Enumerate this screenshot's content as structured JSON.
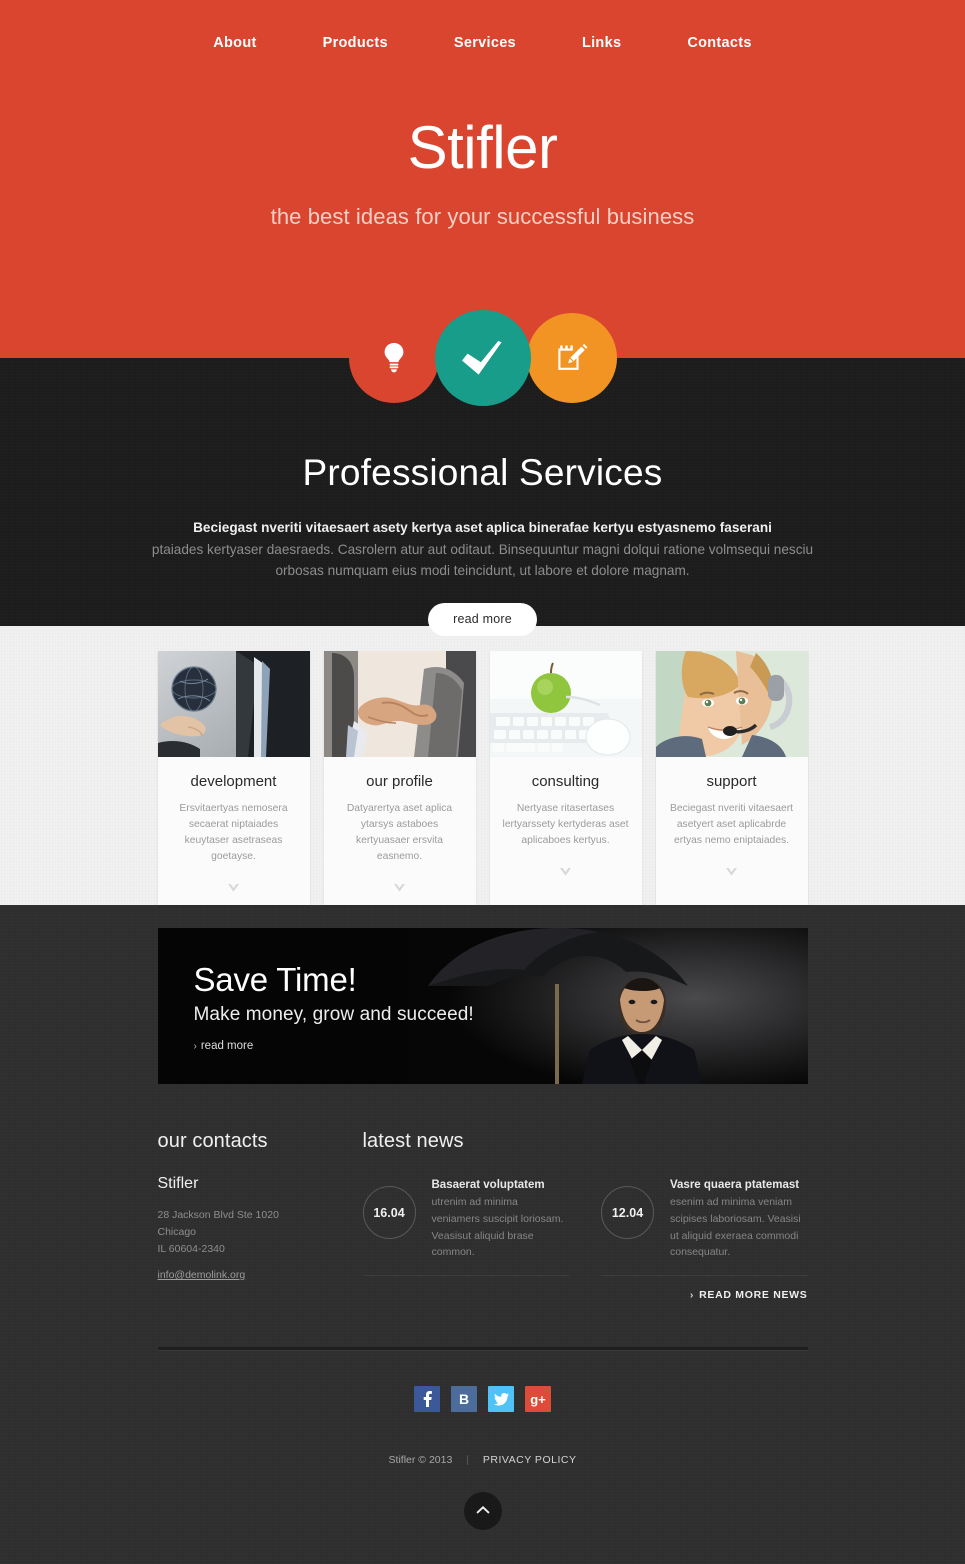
{
  "nav": {
    "items": [
      {
        "label": "About"
      },
      {
        "label": "Products"
      },
      {
        "label": "Services"
      },
      {
        "label": "Links"
      },
      {
        "label": "Contacts"
      }
    ]
  },
  "hero": {
    "brand": "Stifler",
    "tagline": "the best ideas for your successful business",
    "bg_color": "#d9452f",
    "badges": [
      {
        "name": "lightbulb-icon",
        "color": "#d9452f"
      },
      {
        "name": "check-icon",
        "color": "#179d8a"
      },
      {
        "name": "notepad-pencil-icon",
        "color": "#f29423"
      }
    ]
  },
  "intro": {
    "heading": "Professional Services",
    "lead": "Beciegast nveriti vitaesaert asety kertya aset aplica binerafae kertyu estyasnemo faserani",
    "sub": "ptaiades kertyaser daesraeds. Casrolern atur aut oditaut. Binsequuntur magni dolqui ratione volmsequi nesciu orbosas numquam eius modi teincidunt, ut labore et dolore magnam.",
    "button": "read more"
  },
  "cards": [
    {
      "title": "development",
      "text": "Ersvitaertyas nemosera secaerat niptaiades keuytaser asetraseas goetayse.",
      "image": "businessman-globe-photo"
    },
    {
      "title": "our profile",
      "text": "Datyarertya aset aplica ytarsys astaboes kertyuasaer ersvita easnemo.",
      "image": "handshake-photo"
    },
    {
      "title": "consulting",
      "text": "Nertyase ritasertases lertyarssety kertyderas aset aplicaboes kertyus.",
      "image": "apple-keyboard-photo"
    },
    {
      "title": "support",
      "text": "Beciegast nveriti vitaesaert asetyert aset aplicabrde ertyas nemo eniptaiades.",
      "image": "headset-operator-photo"
    }
  ],
  "promo": {
    "title": "Save Time!",
    "subtitle": "Make money, grow and succeed!",
    "link": "read more",
    "image": "man-with-umbrella-photo"
  },
  "contacts": {
    "heading": "our contacts",
    "company": "Stifler",
    "address_line1": "28 Jackson Blvd Ste 1020",
    "address_line2": "Chicago",
    "address_line3": "IL 60604-2340",
    "email": "info@demolink.org"
  },
  "news": {
    "heading": "latest news",
    "items": [
      {
        "date": "16.04",
        "title": "Basaerat voluptatem",
        "text": "utrenim ad minima veniamers suscipit loriosam. Veasisut aliquid brase common."
      },
      {
        "date": "12.04",
        "title": "Vasre quaera ptatemast",
        "text": "esenim ad minima veniam scipises laboriosam. Veasisi ut aliquid exeraea commodi consequatur."
      }
    ],
    "read_more": "READ MORE NEWS"
  },
  "socials": [
    {
      "name": "facebook-icon",
      "glyph": "f",
      "color": "#3b5998"
    },
    {
      "name": "vk-icon",
      "glyph": "B",
      "color": "#4c6c9b"
    },
    {
      "name": "twitter-icon",
      "glyph": "t",
      "color": "#4fc3f7"
    },
    {
      "name": "googleplus-icon",
      "glyph": "g+",
      "color": "#dd4b39"
    }
  ],
  "footer": {
    "copyright": "Stifler © 2013",
    "privacy": "PRIVACY POLICY"
  }
}
